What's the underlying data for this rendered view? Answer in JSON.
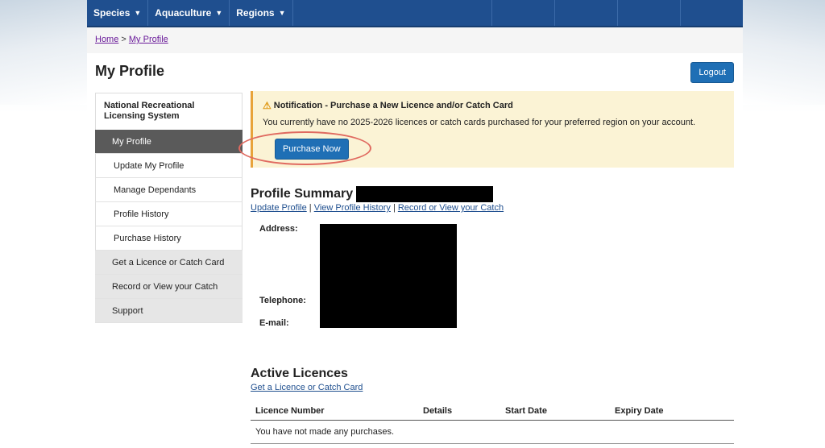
{
  "topnav": {
    "items": [
      {
        "label": "Species"
      },
      {
        "label": "Aquaculture"
      },
      {
        "label": "Regions"
      }
    ]
  },
  "breadcrumb": {
    "home": "Home",
    "separator": ">",
    "current": "My Profile"
  },
  "page": {
    "title": "My Profile",
    "logout_label": "Logout"
  },
  "sidebar": {
    "heading": "National Recreational Licensing System",
    "items": [
      {
        "label": "My Profile"
      },
      {
        "label": "Update My Profile"
      },
      {
        "label": "Manage Dependants"
      },
      {
        "label": "Profile History"
      },
      {
        "label": "Purchase History"
      },
      {
        "label": "Get a Licence or Catch Card"
      },
      {
        "label": "Record or View your Catch"
      },
      {
        "label": "Support"
      }
    ]
  },
  "notification": {
    "title": "Notification - Purchase a New Licence and/or Catch Card",
    "body": "You currently have no 2025-2026 licences or catch cards purchased for your preferred region on your account.",
    "button_label": "Purchase Now",
    "icon": "warning-icon",
    "accent_color": "#e8a33a"
  },
  "profile_summary": {
    "title": "Profile Summary -",
    "links": [
      {
        "label": "Update Profile"
      },
      {
        "label": "View Profile History"
      },
      {
        "label": "Record or View your Catch"
      }
    ],
    "link_separator": "|",
    "address_label": "Address:",
    "telephone_label": "Telephone:",
    "email_label": "E-mail:"
  },
  "active_licences": {
    "title": "Active Licences",
    "link_label": "Get a Licence or Catch Card",
    "columns": [
      "Licence Number",
      "Details",
      "Start Date",
      "Expiry Date"
    ],
    "empty_message": "You have not made any purchases."
  },
  "colors": {
    "nav_bg": "#1f4f8f",
    "button_bg": "#1f6fb5",
    "notification_bg": "#fbf3d5",
    "highlight_ring": "#e06a60"
  }
}
